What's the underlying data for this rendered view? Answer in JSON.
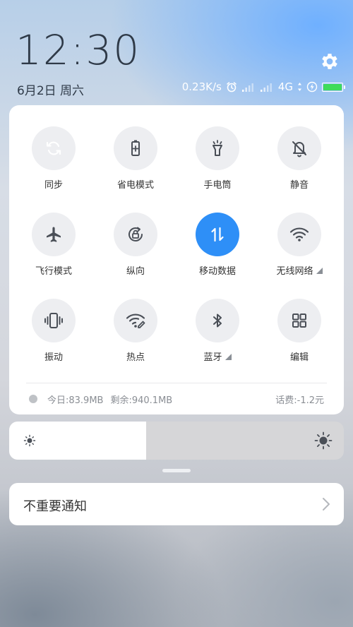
{
  "status_bar": {
    "time": "12:30",
    "date": "6月2日 周六",
    "net_speed": "0.23K/s",
    "network_type": "4G",
    "battery_level": 1.0,
    "battery_color": "#3fdc5a"
  },
  "quick_settings": {
    "accent_color": "#2e8ff7",
    "tiles": [
      {
        "label": "同步",
        "icon": "sync-icon",
        "active": true
      },
      {
        "label": "省电模式",
        "icon": "battery-saver-icon",
        "active": false
      },
      {
        "label": "手电筒",
        "icon": "flashlight-icon",
        "active": false
      },
      {
        "label": "静音",
        "icon": "bell-off-icon",
        "active": false
      },
      {
        "label": "飞行模式",
        "icon": "airplane-icon",
        "active": false
      },
      {
        "label": "纵向",
        "icon": "rotation-lock-icon",
        "active": false
      },
      {
        "label": "移动数据",
        "icon": "mobile-data-icon",
        "active": true
      },
      {
        "label": "无线网络",
        "icon": "wifi-icon",
        "active": false
      },
      {
        "label": "振动",
        "icon": "vibrate-icon",
        "active": false
      },
      {
        "label": "热点",
        "icon": "hotspot-icon",
        "active": false
      },
      {
        "label": "蓝牙",
        "icon": "bluetooth-icon",
        "active": false
      },
      {
        "label": "编辑",
        "icon": "grid-edit-icon",
        "active": false
      }
    ],
    "data_usage": {
      "today": "今日:83.9MB",
      "remaining": "剩余:940.1MB",
      "balance": "话费:-1.2元"
    }
  },
  "brightness": {
    "level": 0.41
  },
  "notifications": {
    "unimportant_label": "不重要通知"
  }
}
